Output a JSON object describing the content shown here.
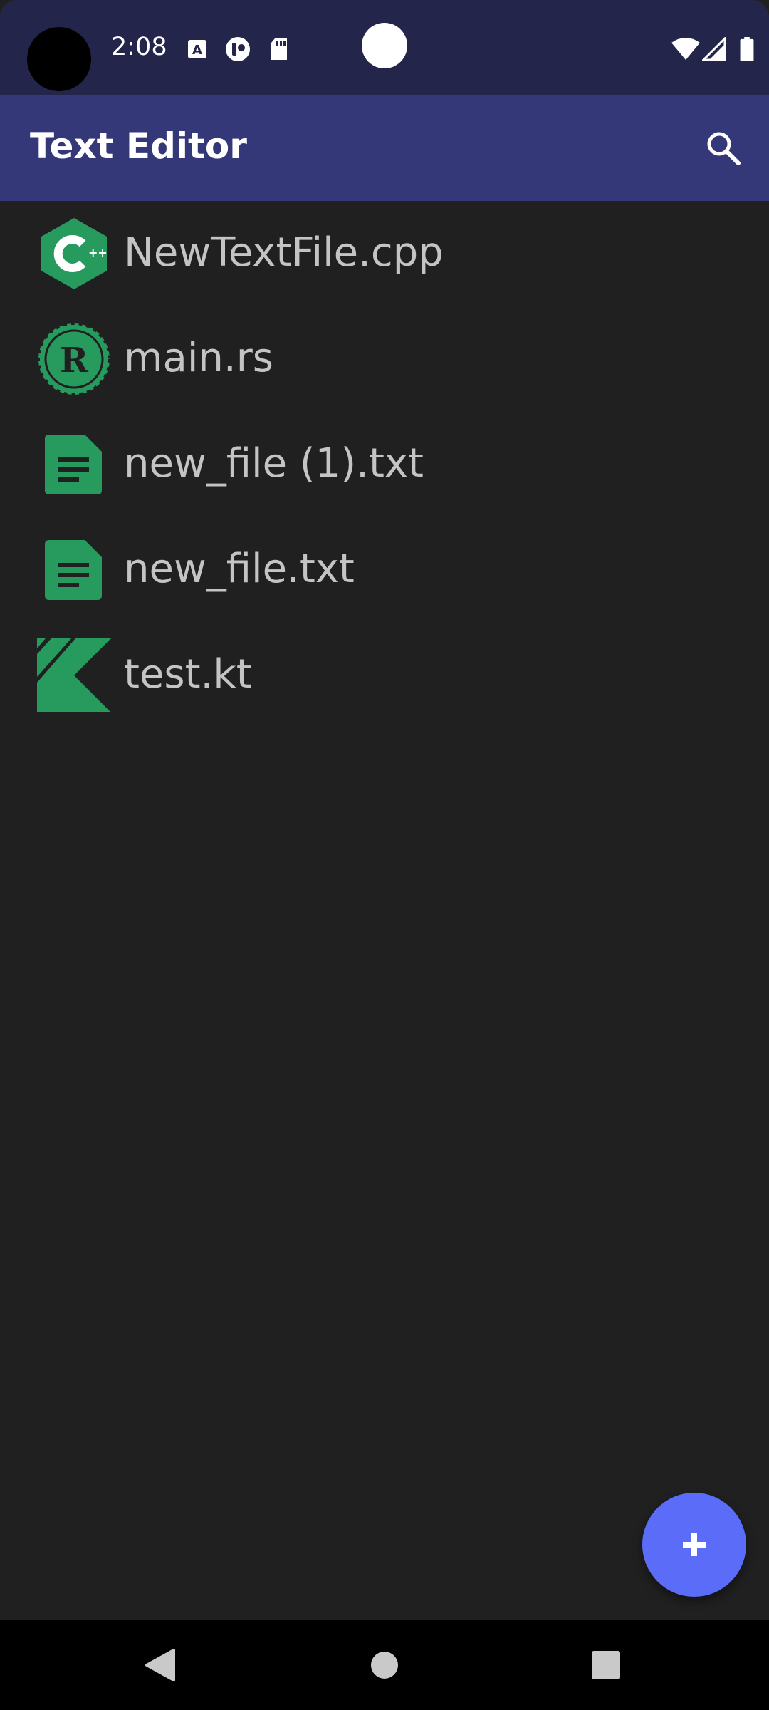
{
  "status_bar": {
    "time": "2:08",
    "icons": [
      "keyboard-a-icon",
      "media-icon",
      "sd-card-icon",
      "wifi-icon",
      "signal-icon",
      "battery-icon"
    ]
  },
  "app_bar": {
    "title": "Text Editor",
    "search_icon": "search-icon"
  },
  "files": [
    {
      "name": "NewTextFile.cpp",
      "icon": "cpp-icon"
    },
    {
      "name": "main.rs",
      "icon": "rust-icon"
    },
    {
      "name": "new_file (1).txt",
      "icon": "text-file-icon"
    },
    {
      "name": "new_file.txt",
      "icon": "text-file-icon"
    },
    {
      "name": "test.kt",
      "icon": "kotlin-icon"
    }
  ],
  "fab": {
    "icon": "plus-icon"
  },
  "nav_bar": {
    "back": "back-icon",
    "home": "home-icon",
    "recents": "recents-icon"
  },
  "colors": {
    "background": "#202020",
    "status_bar": "#23264a",
    "app_bar": "#343878",
    "icon_green": "#279a5e",
    "fab": "#5a6cf8",
    "file_text": "#c4c4c4"
  }
}
